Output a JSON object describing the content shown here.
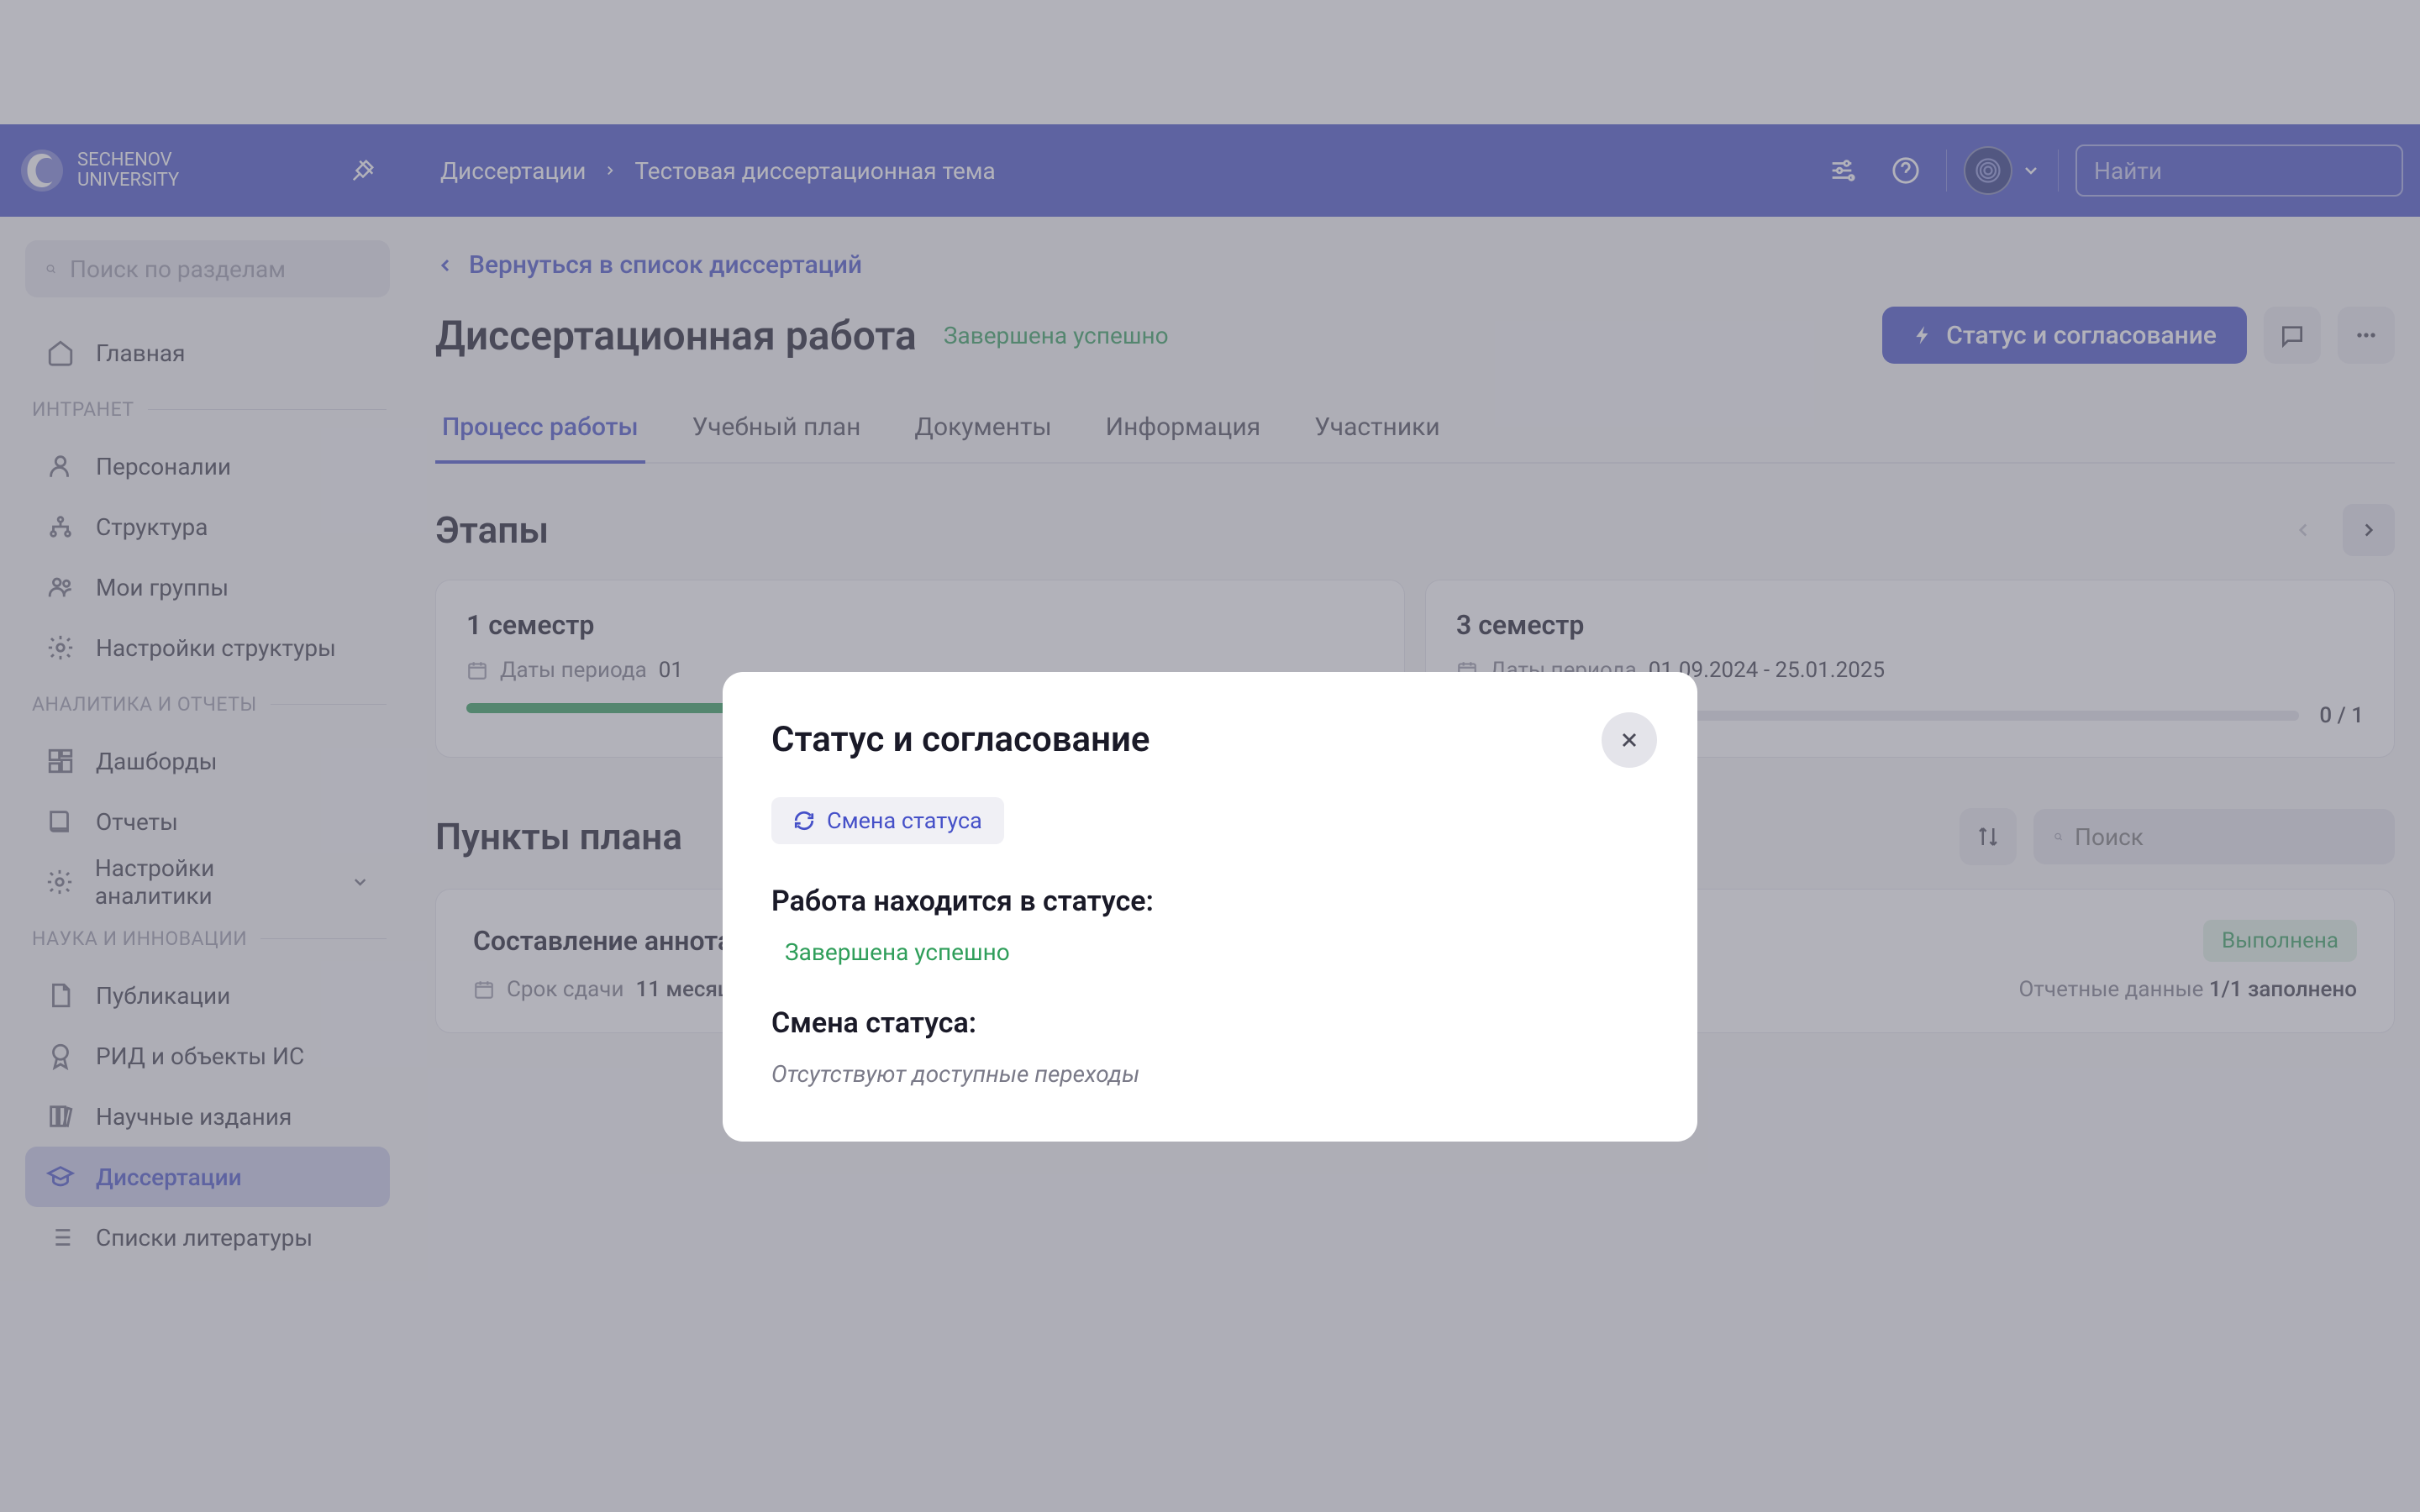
{
  "header": {
    "logo_line1": "SECHENOV",
    "logo_line2": "UNIVERSITY",
    "breadcrumb": [
      "Диссертации",
      "Тестовая диссертационная тема"
    ],
    "search_placeholder": "Найти"
  },
  "sidebar": {
    "search_placeholder": "Поиск по разделам",
    "home": "Главная",
    "sections": [
      {
        "title": "ИНТРАНЕТ",
        "items": [
          {
            "label": "Персоналии",
            "icon": "user"
          },
          {
            "label": "Структура",
            "icon": "tree"
          },
          {
            "label": "Мои группы",
            "icon": "group"
          },
          {
            "label": "Настройки структуры",
            "icon": "gear"
          }
        ]
      },
      {
        "title": "АНАЛИТИКА И ОТЧЕТЫ",
        "items": [
          {
            "label": "Дашборды",
            "icon": "dashboard"
          },
          {
            "label": "Отчеты",
            "icon": "book"
          },
          {
            "label": "Настройки аналитики",
            "icon": "gear",
            "expandable": true
          }
        ]
      },
      {
        "title": "НАУКА И ИННОВАЦИИ",
        "items": [
          {
            "label": "Публикации",
            "icon": "doc"
          },
          {
            "label": "РИД и объекты ИС",
            "icon": "award"
          },
          {
            "label": "Научные издания",
            "icon": "books"
          },
          {
            "label": "Диссертации",
            "icon": "cap",
            "active": true
          },
          {
            "label": "Списки литературы",
            "icon": "list"
          }
        ]
      }
    ]
  },
  "main": {
    "back_link": "Вернуться в список диссертаций",
    "page_title": "Диссертационная работа",
    "status": "Завершена успешно",
    "status_button": "Статус и согласование",
    "tabs": [
      "Процесс работы",
      "Учебный план",
      "Документы",
      "Информация",
      "Участники"
    ],
    "stages_title": "Этапы",
    "stages": [
      {
        "title": "1 семестр",
        "dates_label": "Даты периода",
        "dates_value": "01",
        "progress": 100,
        "count": ""
      },
      {
        "title": "3 семестр",
        "dates_label": "Даты периода",
        "dates_value": "01.09.2024 - 25.01.2025",
        "progress": 0,
        "count": "0 / 1"
      }
    ],
    "plan_title": "Пункты плана",
    "plan_search_placeholder": "Поиск",
    "plan_item": {
      "title": "Составление аннотации к дисс.",
      "due_label": "Срок сдачи",
      "due_value": "11 месяцев, 2 дня",
      "badge": "Выполнена",
      "report_label": "Отчетные данные",
      "report_value": "1/1 заполнено"
    }
  },
  "modal": {
    "title": "Статус и согласование",
    "chip": "Смена статуса",
    "status_label": "Работа находится в статусе:",
    "status_value": "Завершена успешно",
    "change_label": "Смена статуса:",
    "empty": "Отсутствуют доступные переходы"
  }
}
